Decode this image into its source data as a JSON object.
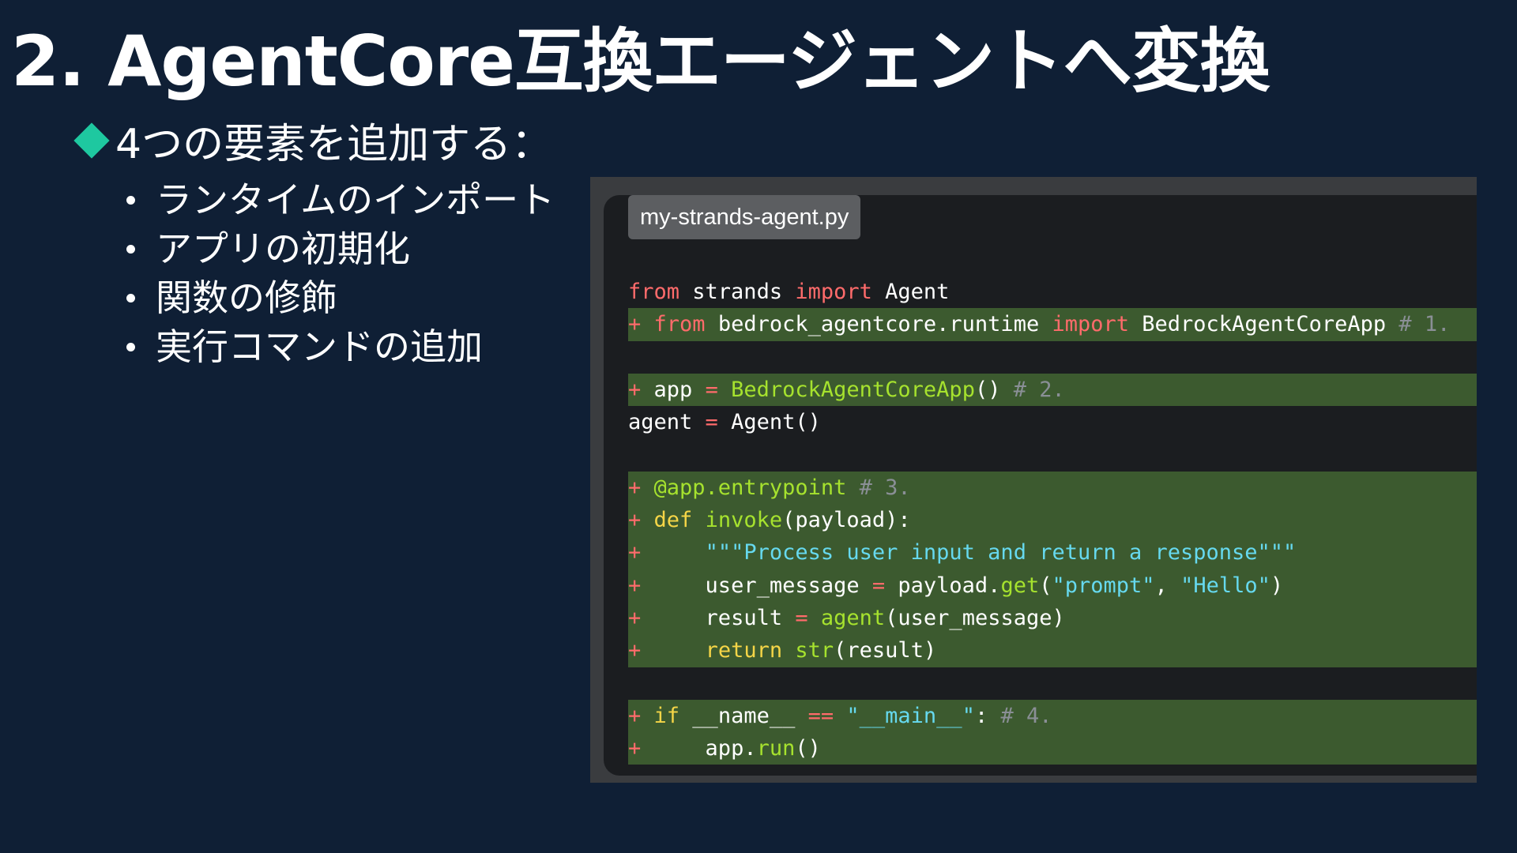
{
  "slide": {
    "title": "2. AgentCore互換エージェントへ変換",
    "main_bullet": "4つの要素を追加する：",
    "sub_bullets": [
      "ランタイムのインポート",
      "アプリの初期化",
      "関数の修飾",
      "実行コマンドの追加"
    ]
  },
  "code_panel": {
    "filename": "my-strands-agent.py",
    "lines": [
      {
        "added": false,
        "code": "from strands import Agent"
      },
      {
        "added": true,
        "code": "from bedrock_agentcore.runtime import BedrockAgentCoreApp # 1."
      },
      {
        "added": false,
        "code": ""
      },
      {
        "added": true,
        "code": "app = BedrockAgentCoreApp() # 2."
      },
      {
        "added": false,
        "code": "agent = Agent()"
      },
      {
        "added": false,
        "code": ""
      },
      {
        "added": true,
        "code": "@app.entrypoint # 3."
      },
      {
        "added": true,
        "code": "def invoke(payload):"
      },
      {
        "added": true,
        "code": "    \"\"\"Process user input and return a response\"\"\""
      },
      {
        "added": true,
        "code": "    user_message = payload.get(\"prompt\", \"Hello\")"
      },
      {
        "added": true,
        "code": "    result = agent(user_message)"
      },
      {
        "added": true,
        "code": "    return str(result)"
      },
      {
        "added": false,
        "code": ""
      },
      {
        "added": true,
        "code": "if __name__ == \"__main__\": # 4."
      },
      {
        "added": true,
        "code": "    app.run()"
      }
    ]
  },
  "colors": {
    "background": "#0f1f35",
    "bullet_accent": "#1ec8a0",
    "code_background": "#1b1d20",
    "added_line": "#3c5a2f",
    "keyword": "#ff6b6b",
    "keyword_control": "#f5d547",
    "function": "#a6e22e",
    "string": "#66d9ef",
    "comment": "#8a8f96"
  }
}
